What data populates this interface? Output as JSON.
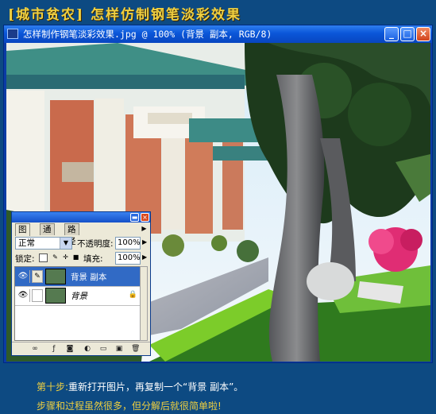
{
  "banner": {
    "title": "[城市贫农]  怎样仿制钢笔淡彩效果"
  },
  "window": {
    "title": "怎样制作钢笔淡彩效果.jpg @ 100% (背景 副本, RGB/8)",
    "min_glyph": "_",
    "max_glyph": "□",
    "close_glyph": "×"
  },
  "layers_panel": {
    "tabs": [
      {
        "label": "图层",
        "active": true
      },
      {
        "label": "通道",
        "active": false
      },
      {
        "label": "路径",
        "active": false
      }
    ],
    "blend_mode": "正常",
    "opacity_label": "不透明度:",
    "opacity_value": "100%",
    "lock_label": "锁定:",
    "fill_label": "填充:",
    "fill_value": "100%",
    "layers": [
      {
        "name": "背景 副本",
        "selected": true,
        "visible": true,
        "italic": false
      },
      {
        "name": "背景",
        "selected": false,
        "visible": true,
        "italic": true,
        "locked": true
      }
    ],
    "bottom_icons": [
      "link-icon",
      "layer-style-icon",
      "mask-icon",
      "fill-adjust-icon",
      "new-set-icon",
      "new-layer-icon",
      "trash-icon"
    ]
  },
  "captions": {
    "step_label": "第十步:",
    "step_text": "重新打开图片，再复制一个“背景 副本”。",
    "line2": "步骤和过程虽然很多，但分解后就很简单啦!"
  },
  "colors": {
    "page_bg": "#0d4a82",
    "banner_text": "#f0d040",
    "titlebar": "#0a56d8",
    "selection": "#316ac5"
  }
}
